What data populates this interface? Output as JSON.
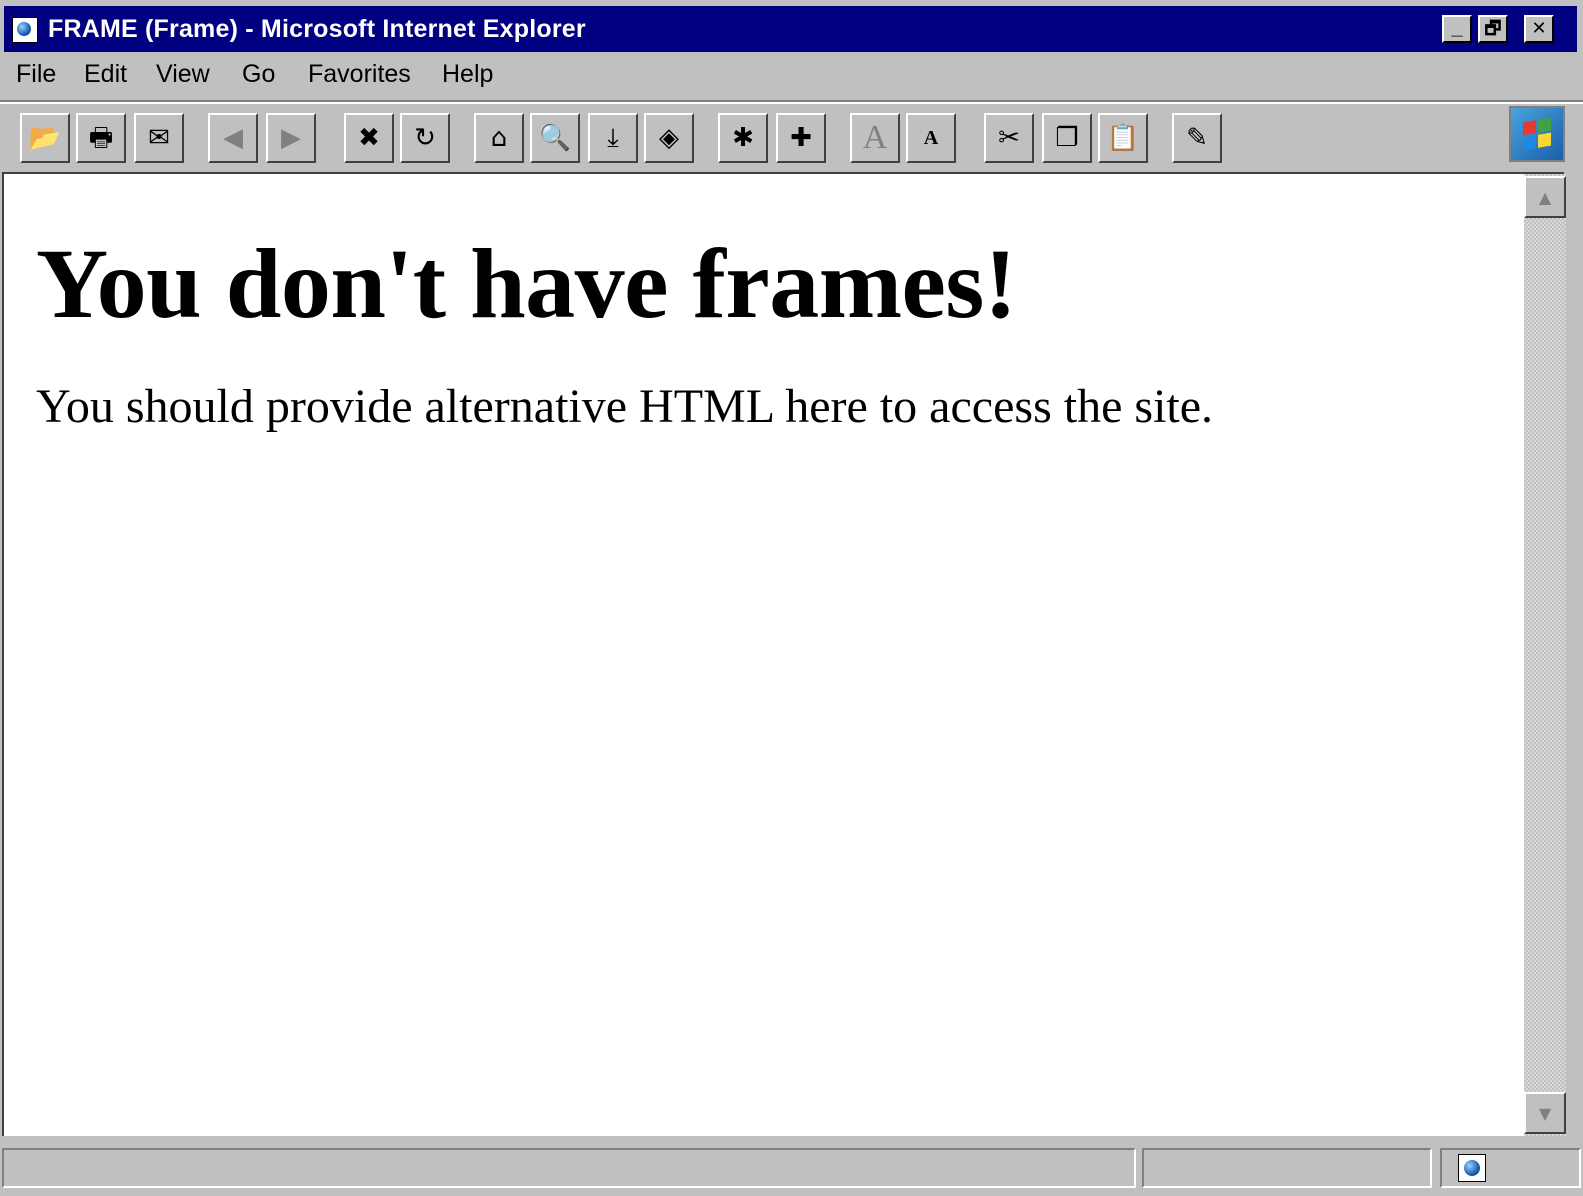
{
  "window": {
    "title": "FRAME (Frame) - Microsoft Internet Explorer",
    "controls": {
      "minimize": "_",
      "restore": "🗗",
      "close": "✕"
    }
  },
  "menu": {
    "items": [
      {
        "label": "File",
        "icon": ""
      },
      {
        "label": "Edit"
      },
      {
        "label": "View"
      },
      {
        "label": "Go"
      },
      {
        "label": "Favorites"
      },
      {
        "label": "Help"
      }
    ]
  },
  "toolbar": {
    "buttons": [
      {
        "name": "open-button",
        "icon": "open-folder-icon",
        "glyph": "📂"
      },
      {
        "name": "print-button",
        "icon": "printer-icon",
        "glyph": "🖶"
      },
      {
        "name": "mail-button",
        "icon": "mail-icon",
        "glyph": "✉"
      },
      {
        "name": "back-button",
        "icon": "back-arrow-icon",
        "glyph": "◀",
        "disabled": true
      },
      {
        "name": "forward-button",
        "icon": "forward-arrow-icon",
        "glyph": "▶",
        "disabled": true
      },
      {
        "name": "stop-button",
        "icon": "stop-icon",
        "glyph": "✖"
      },
      {
        "name": "refresh-button",
        "icon": "refresh-icon",
        "glyph": "↻"
      },
      {
        "name": "home-button",
        "icon": "home-icon",
        "glyph": "⌂"
      },
      {
        "name": "search-button",
        "icon": "search-icon",
        "glyph": "🔍"
      },
      {
        "name": "download-button",
        "icon": "download-icon",
        "glyph": "⤓"
      },
      {
        "name": "news-button",
        "icon": "news-icon",
        "glyph": "◈"
      },
      {
        "name": "favorites-folder-button",
        "icon": "favorites-folder-icon",
        "glyph": "✱"
      },
      {
        "name": "add-favorite-button",
        "icon": "add-favorite-icon",
        "glyph": "✚"
      },
      {
        "name": "font-larger-button",
        "icon": "font-larger-icon",
        "glyph": "A",
        "disabled": true
      },
      {
        "name": "font-smaller-button",
        "icon": "font-smaller-icon",
        "glyph": "A"
      },
      {
        "name": "cut-button",
        "icon": "scissors-icon",
        "glyph": "✂"
      },
      {
        "name": "copy-button",
        "icon": "copy-icon",
        "glyph": "❐"
      },
      {
        "name": "paste-button",
        "icon": "paste-icon",
        "glyph": "📋"
      },
      {
        "name": "edit-page-button",
        "icon": "edit-page-icon",
        "glyph": "✎"
      }
    ]
  },
  "page": {
    "heading": "You don't have frames!",
    "body": "You should provide alternative HTML here to access the site."
  },
  "scrollbar": {
    "up_glyph": "▲",
    "down_glyph": "▼"
  },
  "statusbar": {
    "text": "",
    "zone": ""
  },
  "colors": {
    "titlebar": "#000080",
    "chrome": "#c0c0c0",
    "content_bg": "#ffffff"
  }
}
